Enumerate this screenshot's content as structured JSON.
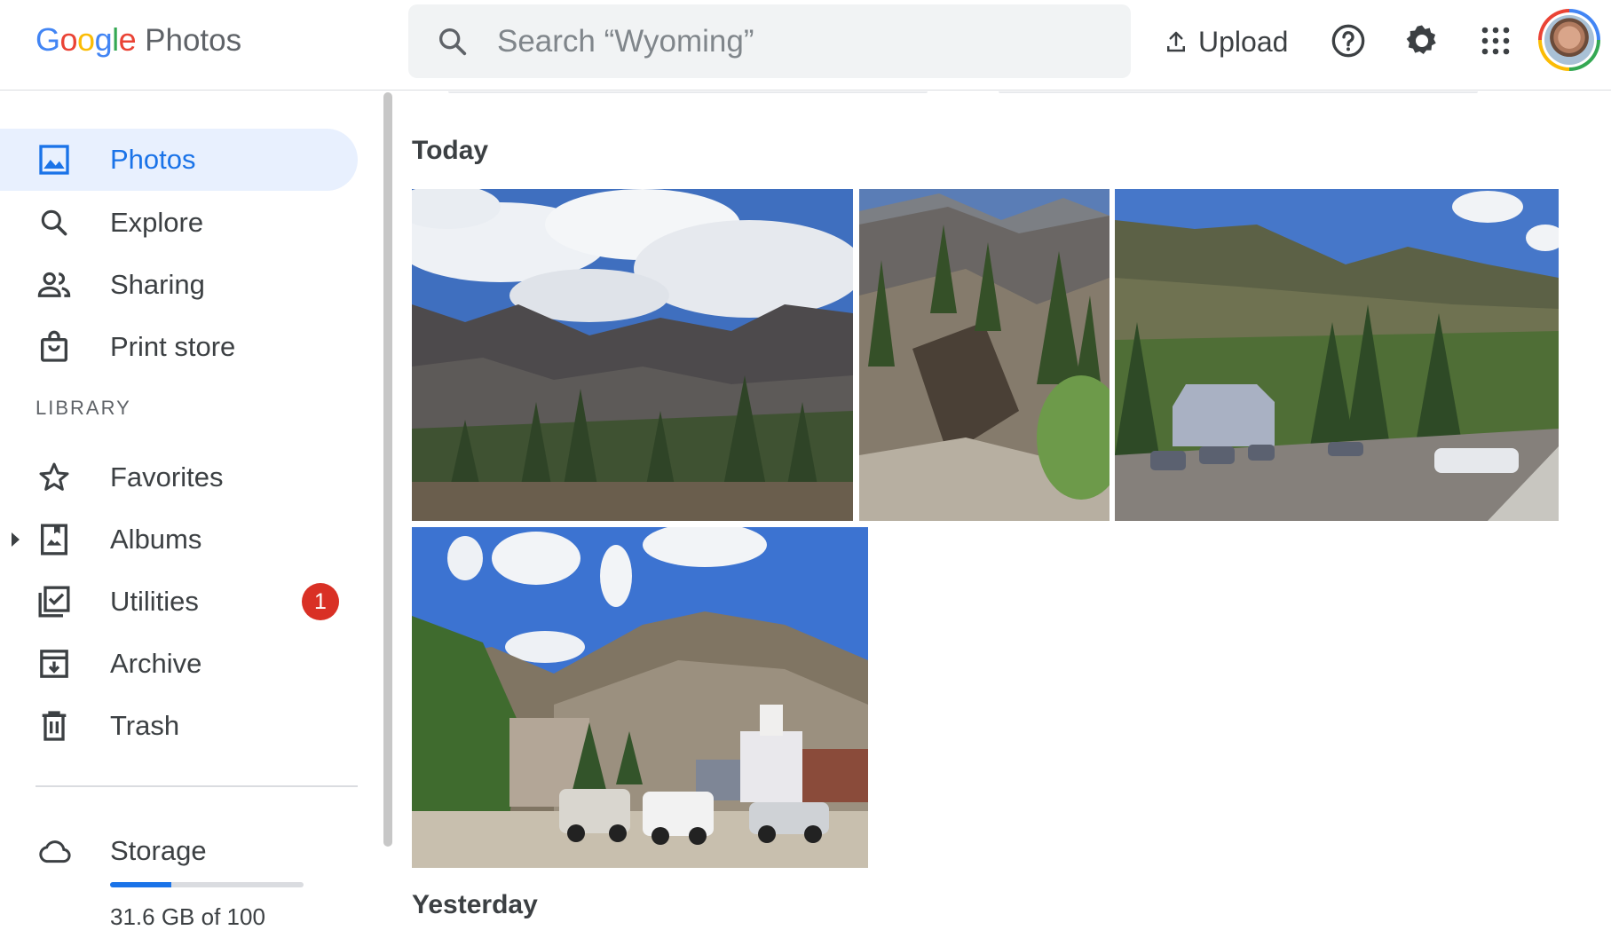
{
  "header": {
    "logo_letters": [
      {
        "char": "G",
        "color": "#4285f4"
      },
      {
        "char": "o",
        "color": "#ea4335"
      },
      {
        "char": "o",
        "color": "#fbbc05"
      },
      {
        "char": "g",
        "color": "#4285f4"
      },
      {
        "char": "l",
        "color": "#34a853"
      },
      {
        "char": "e",
        "color": "#ea4335"
      }
    ],
    "logo_product": "Photos",
    "search_placeholder": "Search “Wyoming”",
    "upload_label": "Upload",
    "icons": [
      "search-icon",
      "upload-icon",
      "help-icon",
      "settings-icon",
      "apps-icon",
      "avatar"
    ]
  },
  "sidebar": {
    "items": [
      {
        "label": "Photos",
        "icon": "photo-icon",
        "active": true
      },
      {
        "label": "Explore",
        "icon": "search-icon"
      },
      {
        "label": "Sharing",
        "icon": "people-icon"
      },
      {
        "label": "Print store",
        "icon": "shopping-bag-icon"
      }
    ],
    "library_label": "LIBRARY",
    "library_items": [
      {
        "label": "Favorites",
        "icon": "star-icon"
      },
      {
        "label": "Albums",
        "icon": "album-icon"
      },
      {
        "label": "Utilities",
        "icon": "utilities-icon",
        "badge": "1"
      },
      {
        "label": "Archive",
        "icon": "archive-icon"
      },
      {
        "label": "Trash",
        "icon": "trash-icon"
      }
    ],
    "storage": {
      "label": "Storage",
      "icon": "cloud-icon",
      "text": "31.6 GB of 100",
      "used_fraction": 0.316
    }
  },
  "main": {
    "sections": [
      {
        "heading": "Today",
        "photo_count": 4
      },
      {
        "heading": "Yesterday"
      }
    ]
  },
  "colors": {
    "accent": "#1a73e8",
    "active_bg": "#e8f0fe",
    "badge": "#d93025"
  }
}
